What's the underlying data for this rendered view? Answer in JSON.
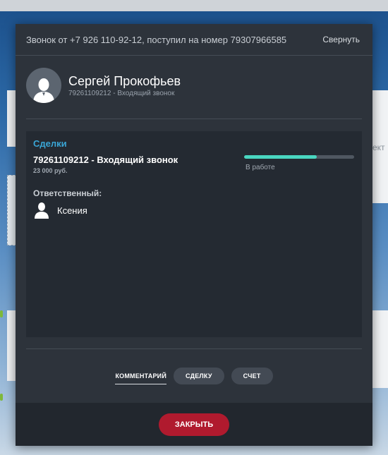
{
  "background": {
    "right_fragment_text": "ект"
  },
  "modal": {
    "title": "Звонок от +7 926 110-92-12, поступил на номер 79307966585",
    "collapse_label": "Свернуть",
    "contact": {
      "name": "Сергей Прокофьев",
      "subtitle": "79261109212 - Входящий звонок",
      "avatar_icon": "user-avatar-icon"
    },
    "deals": {
      "title": "Сделки",
      "item": {
        "name": "79261109212 - Входящий звонок",
        "price": "23 000 руб.",
        "status": "В работе",
        "progress": 0.66
      },
      "responsible_label": "Ответственный:",
      "responsible_name": "Ксения",
      "responsible_icon": "person-icon"
    },
    "tabs": [
      {
        "label": "КОММЕНТАРИЙ"
      },
      {
        "label": "СДЕЛКУ"
      },
      {
        "label": "СЧЕТ"
      }
    ],
    "close_label": "ЗАКРЫТЬ"
  },
  "colors": {
    "accent_blue": "#3aa6d6",
    "progress_fill": "#49d6c0",
    "close_button": "#b01a2e",
    "modal_bg": "#2d333b"
  }
}
